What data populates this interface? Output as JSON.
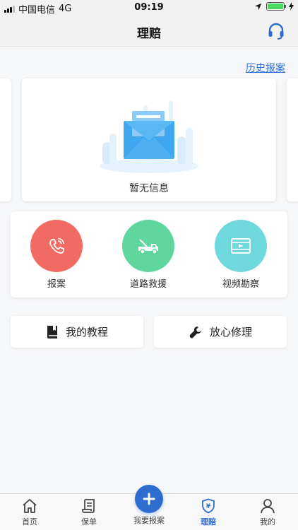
{
  "status_bar": {
    "carrier": "中国电信",
    "network": "4G",
    "time": "09:19"
  },
  "nav": {
    "title": "理赔",
    "service_icon": "headset-icon"
  },
  "history_link": "历史报案",
  "carousel": {
    "empty_text": "暂无信息"
  },
  "services": [
    {
      "label": "报案",
      "icon": "phone-icon",
      "color": "#f16b63"
    },
    {
      "label": "道路救援",
      "icon": "tow-truck-icon",
      "color": "#5fd69b"
    },
    {
      "label": "视频勘察",
      "icon": "video-icon",
      "color": "#6fd8dc"
    }
  ],
  "actions": [
    {
      "label": "我的教程",
      "icon": "book-icon"
    },
    {
      "label": "放心修理",
      "icon": "wrench-icon"
    }
  ],
  "tabs": [
    {
      "label": "首页",
      "icon": "home-icon"
    },
    {
      "label": "保单",
      "icon": "policy-icon"
    },
    {
      "label": "我要报案",
      "icon": "plus-icon"
    },
    {
      "label": "理赔",
      "icon": "claim-shield-icon"
    },
    {
      "label": "我的",
      "icon": "user-icon"
    }
  ],
  "colors": {
    "accent": "#2f6ccf",
    "link": "#2a6fd6"
  }
}
